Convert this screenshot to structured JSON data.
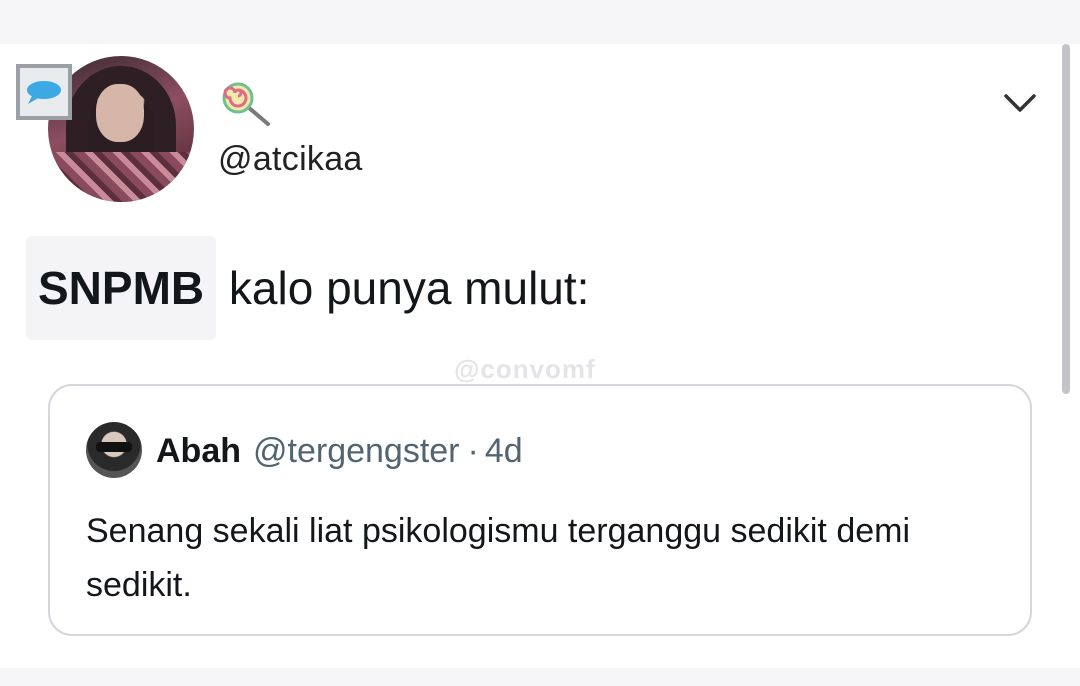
{
  "author": {
    "handle": "@atcikaa",
    "badge_icon": "chat-bubble-icon",
    "emoji_icon": "lollipop-icon"
  },
  "tweet": {
    "highlighted_word": "SNPMB",
    "text_rest": " kalo punya mulut:"
  },
  "watermark": "@convomf",
  "quoted_tweet": {
    "display_name": "Abah",
    "handle": "@tergengster",
    "separator": "·",
    "time": "4d",
    "text": "Senang sekali liat psikologismu terganggu sedikit demi sedikit."
  },
  "menu_icon": "chevron-down-icon",
  "colors": {
    "background": "#f6f6f8",
    "card": "#ffffff",
    "border": "#d3d6da",
    "muted_text": "#536471"
  }
}
